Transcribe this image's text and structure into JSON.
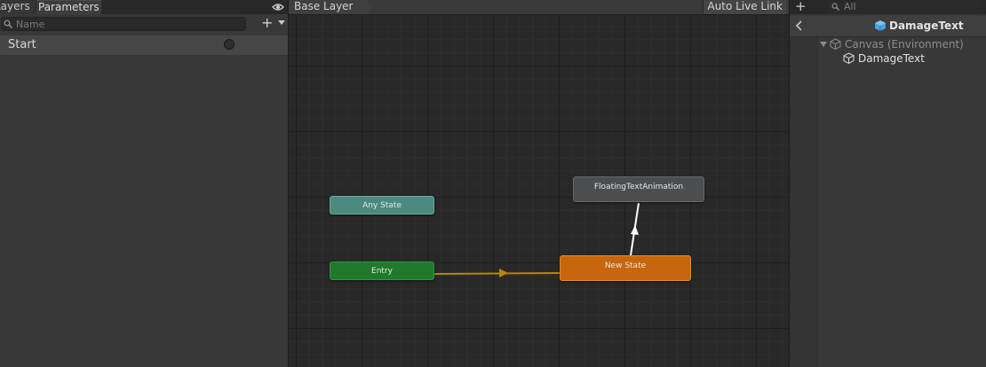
{
  "left_panel": {
    "tabs": [
      {
        "label": "Layers"
      },
      {
        "label": "Parameters"
      }
    ],
    "search": {
      "placeholder": "Name",
      "value": ""
    },
    "add_label": "+",
    "parameters": [
      {
        "name": "Start",
        "type": "trigger"
      }
    ]
  },
  "graph": {
    "breadcrumb": "Base Layer",
    "auto_live_link": "Auto Live Link",
    "nodes": {
      "any_state": "Any State",
      "entry": "Entry",
      "new_state": "New State",
      "floating": "FloatingTextAnimation"
    },
    "colors": {
      "any_state": "#4c8a80",
      "entry": "#1f7a2b",
      "new_state": "#c7660d",
      "floating": "#4b4d50",
      "transition_entry": "#b8860b",
      "transition_state": "#ffffff"
    }
  },
  "right_panel": {
    "search": {
      "placeholder": "All"
    },
    "add_label": "+",
    "header_title": "DamageText",
    "tree": [
      {
        "label": "Canvas (Environment)",
        "expanded": true
      },
      {
        "label": "DamageText"
      }
    ]
  }
}
